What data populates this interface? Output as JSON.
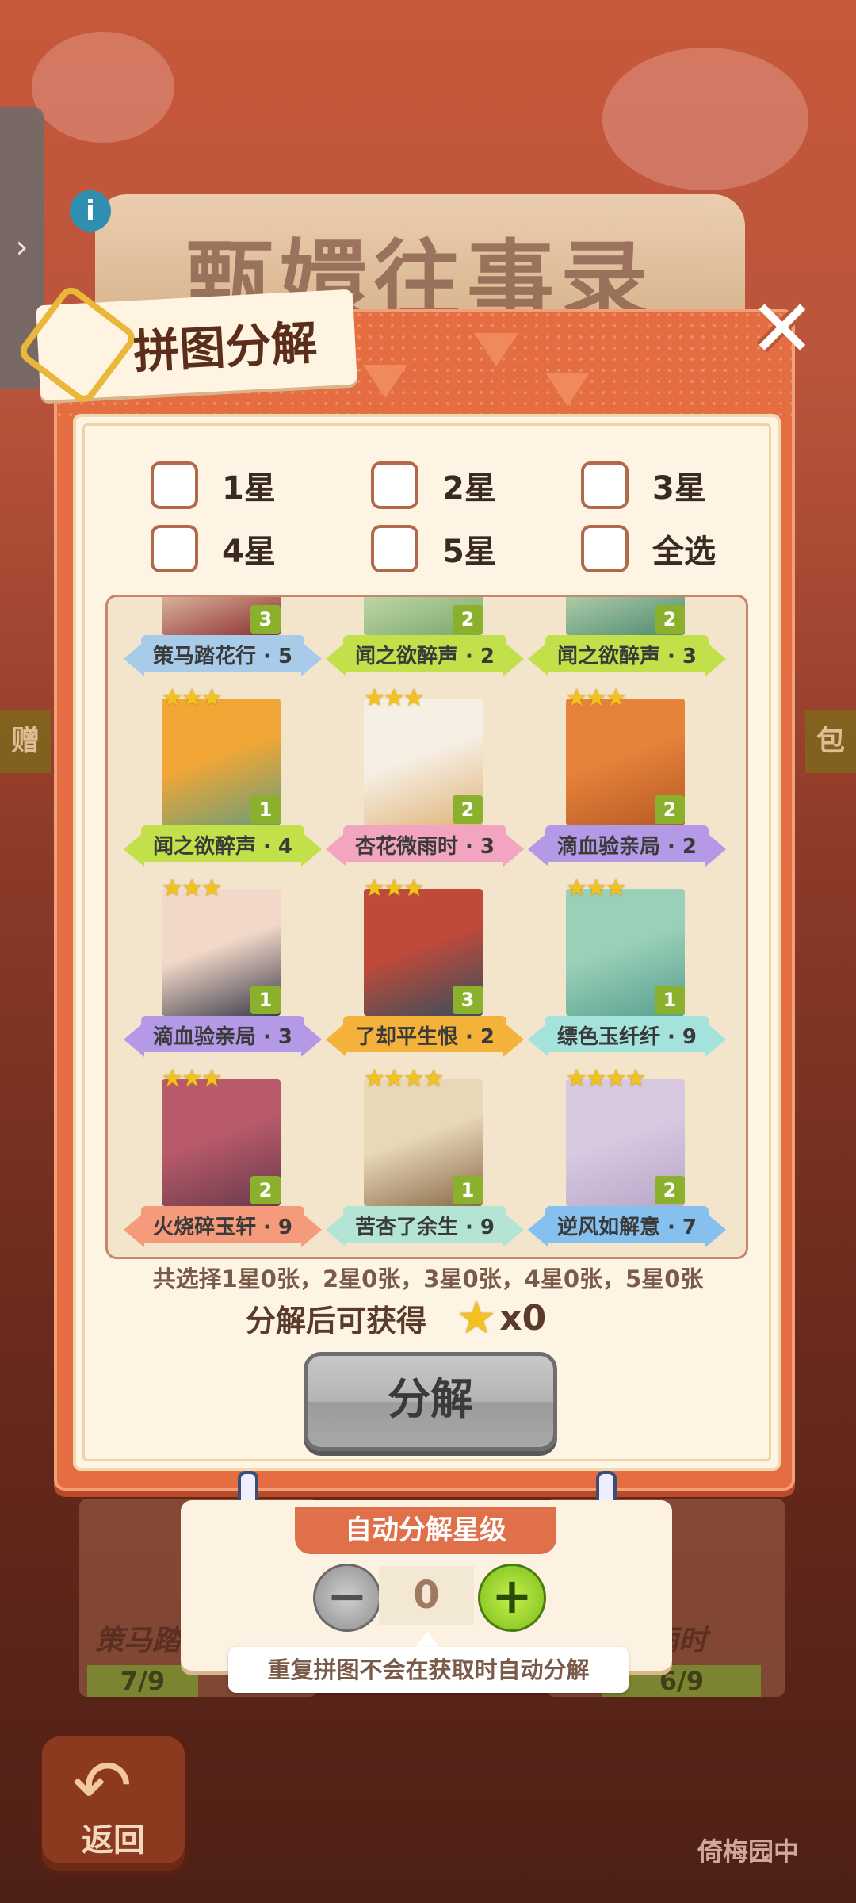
{
  "background": {
    "title": "甄嬛往事录",
    "left_strip": "赠",
    "right_strip": "包",
    "back_label": "返回",
    "garden_label": "倚梅园中",
    "bg_card_left": "策马踏",
    "bg_card_right": "雨时",
    "bg_progress_left": "7/9",
    "bg_progress_right": "6/9"
  },
  "dialog": {
    "title": "拼图分解",
    "close_label": "✕",
    "checkboxes": [
      "1星",
      "2星",
      "3星",
      "4星",
      "5星",
      "全选"
    ],
    "cards": [
      {
        "name": "策马踏花行 · 5",
        "count": "3",
        "stars": "",
        "ribbon": "blue",
        "img": [
          "#e6c4a8",
          "#8a2e2e"
        ]
      },
      {
        "name": "闻之欲醉声 · 2",
        "count": "2",
        "stars": "",
        "ribbon": "green",
        "img": [
          "#c8dcb0",
          "#7aa86a"
        ]
      },
      {
        "name": "闻之欲醉声 · 3",
        "count": "2",
        "stars": "",
        "ribbon": "green",
        "img": [
          "#bcd4b0",
          "#4c8a70"
        ]
      },
      {
        "name": "闻之欲醉声 · 4",
        "count": "1",
        "stars": "★★★",
        "ribbon": "green",
        "img": [
          "#f2a636",
          "#6a9e78"
        ]
      },
      {
        "name": "杏花微雨时 · 3",
        "count": "2",
        "stars": "★★★",
        "ribbon": "pink",
        "img": [
          "#f6efe4",
          "#e0b47a"
        ]
      },
      {
        "name": "滴血验亲局 · 2",
        "count": "2",
        "stars": "★★★",
        "ribbon": "purple",
        "img": [
          "#e6823a",
          "#b85a26"
        ]
      },
      {
        "name": "滴血验亲局 · 3",
        "count": "1",
        "stars": "★★★",
        "ribbon": "purple",
        "img": [
          "#f2d8c8",
          "#3a3a4a"
        ]
      },
      {
        "name": "了却平生恨 · 2",
        "count": "3",
        "stars": "★★★",
        "ribbon": "orange",
        "img": [
          "#c04a3a",
          "#3a4e5a"
        ]
      },
      {
        "name": "缥色玉纤纤 · 9",
        "count": "1",
        "stars": "★★★",
        "ribbon": "teal",
        "img": [
          "#9ad0b8",
          "#5aa090"
        ]
      },
      {
        "name": "火烧碎玉轩 · 9",
        "count": "2",
        "stars": "★★★",
        "ribbon": "salmon",
        "img": [
          "#b85a6a",
          "#6a3a4a"
        ]
      },
      {
        "name": "苦杏了余生 · 9",
        "count": "1",
        "stars": "★★★★",
        "ribbon": "mint",
        "img": [
          "#e8d8b8",
          "#8a6a4a"
        ]
      },
      {
        "name": "逆风如解意 · 7",
        "count": "2",
        "stars": "★★★★",
        "ribbon": "sky",
        "img": [
          "#d8c8e0",
          "#b8a8c8"
        ]
      }
    ],
    "summary": "共选择1星0张，2星0张，3星0张，4星0张，5星0张",
    "reward_label": "分解后可获得",
    "reward_value": "x0",
    "decompose_button": "分解"
  },
  "auto_panel": {
    "title": "自动分解星级",
    "level": "0",
    "minus": "−",
    "plus": "+",
    "hint": "重复拼图不会在获取时自动分解"
  },
  "colors": {
    "dialog": "#e46d42",
    "panel": "#fdf4e4",
    "ribbon_blue": "#a9cbea",
    "ribbon_green": "#c2e04a",
    "ribbon_pink": "#f2a4c0",
    "ribbon_purple": "#b49ae6",
    "ribbon_orange": "#f4b23a",
    "ribbon_teal": "#a4e2dc",
    "ribbon_salmon": "#f59a7a",
    "ribbon_mint": "#b4e4d4",
    "ribbon_sky": "#86c0ee"
  }
}
